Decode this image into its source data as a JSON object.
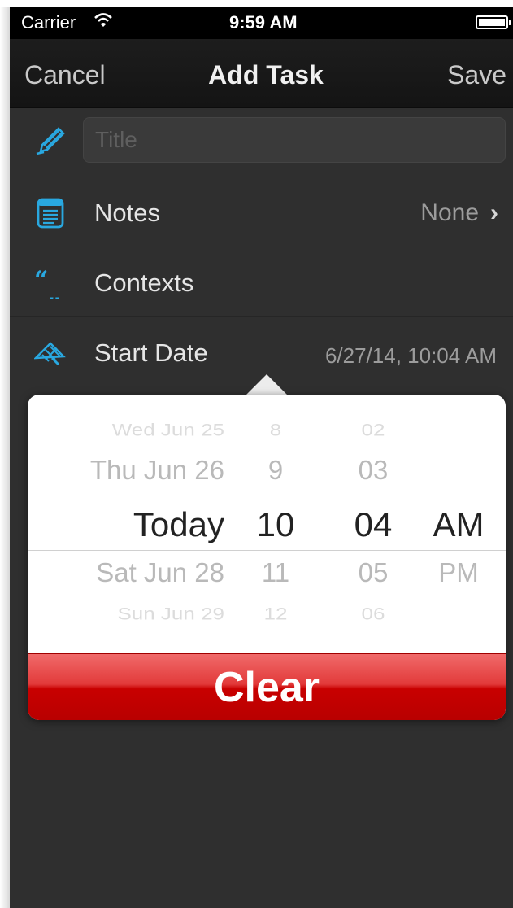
{
  "status_bar": {
    "carrier": "Carrier",
    "time": "9:59 AM",
    "wifi_icon": "wifi-icon",
    "battery_icon": "battery-icon"
  },
  "nav": {
    "cancel_label": "Cancel",
    "title": "Add Task",
    "save_label": "Save"
  },
  "form": {
    "title_placeholder": "Title",
    "title_value": "",
    "notes": {
      "label": "Notes",
      "value": "None",
      "icon": "notes-icon"
    },
    "contexts": {
      "label": "Contexts",
      "icon": "quote-icon"
    },
    "start_date": {
      "label": "Start Date",
      "value": "6/27/14, 10:04 AM",
      "icon": "start-date-icon"
    },
    "title_icon": "pencil-icon"
  },
  "picker": {
    "dates": [
      "Wed Jun 25",
      "Thu Jun 26",
      "Today",
      "Sat Jun 28",
      "Sun Jun 29"
    ],
    "hours": [
      "8",
      "9",
      "10",
      "11",
      "12"
    ],
    "minutes": [
      "02",
      "03",
      "04",
      "05",
      "06"
    ],
    "ampm": [
      "",
      "",
      "AM",
      "PM",
      ""
    ],
    "selected": {
      "date": "Today",
      "hour": "10",
      "minute": "04",
      "ampm": "AM"
    }
  },
  "clear_label": "Clear",
  "colors": {
    "accent_icon": "#29a8e0",
    "clear_button": "#c80000",
    "background": "#2f2f2f"
  }
}
